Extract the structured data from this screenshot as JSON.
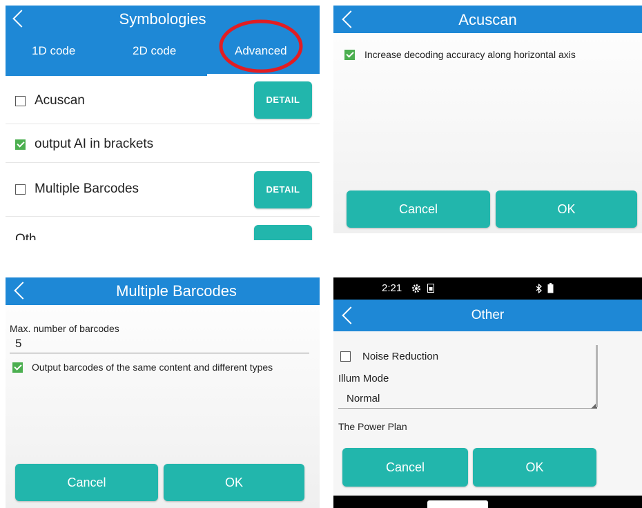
{
  "panel1": {
    "title": "Symbologies",
    "tabs": [
      {
        "label": "1D code"
      },
      {
        "label": "2D code"
      },
      {
        "label": "Advanced",
        "selected": true
      }
    ],
    "rows": [
      {
        "label": "Acuscan",
        "checked": false,
        "button": "DETAIL"
      },
      {
        "label": "output AI in brackets",
        "checked": true
      },
      {
        "label": "Multiple Barcodes",
        "checked": false,
        "button": "DETAIL"
      },
      {
        "label": "Oth",
        "checked": false
      }
    ],
    "highlight_color": "#e11d23"
  },
  "panel2": {
    "title": "Acuscan",
    "option": {
      "label": "Increase decoding accuracy along horizontal axis",
      "checked": true
    },
    "cancel": "Cancel",
    "ok": "OK"
  },
  "panel3": {
    "title": "Multiple Barcodes",
    "field_label": "Max. number of barcodes",
    "field_value": "5",
    "option": {
      "label": "Output barcodes of the same content and different types",
      "checked": true
    },
    "cancel": "Cancel",
    "ok": "OK"
  },
  "panel4": {
    "status_time": "2:21",
    "title": "Other",
    "noise": {
      "label": "Noise Reduction",
      "checked": false
    },
    "illum_label": "Illum Mode",
    "illum_value": "Normal",
    "power_label": "The Power Plan",
    "cancel": "Cancel",
    "ok": "OK"
  },
  "colors": {
    "header": "#1e88d6",
    "button": "#22b6ac",
    "check": "#4caf50"
  }
}
